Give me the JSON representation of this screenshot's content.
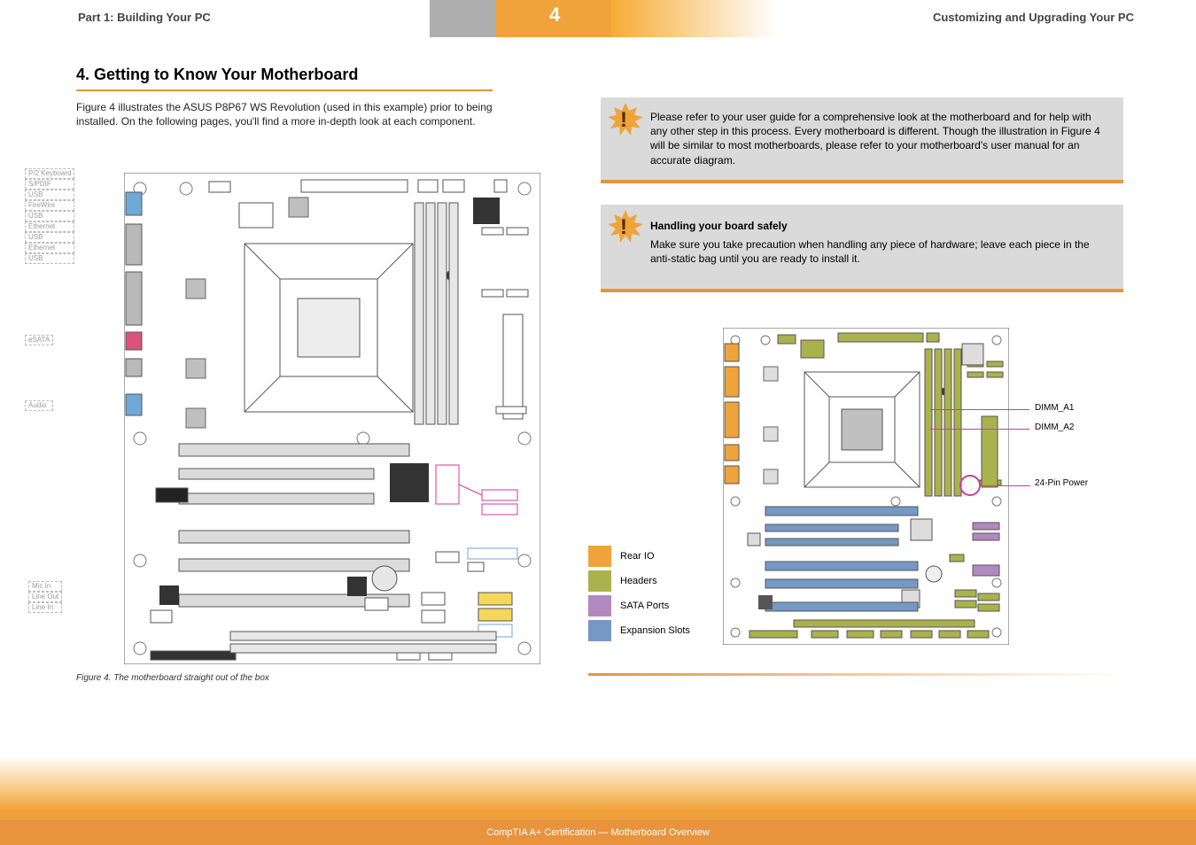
{
  "page": {
    "number": "4",
    "header_left": "Part 1: Building Your PC",
    "header_right": "Customizing and Upgrading Your PC"
  },
  "section4": {
    "title": "4. Getting to Know Your Motherboard",
    "subtitle": "Figure 4 illustrates the ASUS P8P67 WS Revolution (used in this example) prior to being installed. On the following pages, you'll find a more in-depth look at each component."
  },
  "figure_caption": "Figure 4. The motherboard straight out of the box",
  "left_callouts": {
    "top": [
      "P/2 Keyboard",
      "S/PDIF",
      "USB",
      "FireWire",
      "USB",
      "Ethernet",
      "USB",
      "Ethernet",
      "USB"
    ],
    "mid": [
      "eSATA",
      "Audio"
    ],
    "bottom": [
      "Mic In",
      "Line Out",
      "Line In"
    ]
  },
  "right_notes": {
    "note1": "Please refer to your user guide for a comprehensive look at the motherboard and for help with any other step in this process. Every motherboard is different. Though the illustration in Figure 4 will be similar to most motherboards, please refer to your motherboard's user manual for an accurate diagram.",
    "note2_title": "Handling your board safely",
    "note2_text": "Make sure you take precaution when handling any piece of hardware; leave each piece in the anti-static bag until you are ready to install it."
  },
  "mini_labels": {
    "a": "DIMM_A1",
    "b": "DIMM_A2",
    "pwr": "24-Pin Power"
  },
  "color_key": [
    {
      "color": "#F0A33A",
      "label": "Rear IO"
    },
    {
      "color": "#A9B24C",
      "label": "Headers"
    },
    {
      "color": "#B189BF",
      "label": "SATA Ports"
    },
    {
      "color": "#7598C5",
      "label": "Expansion Slots"
    }
  ],
  "footer": "CompTIA A+ Certification — Motherboard Overview"
}
